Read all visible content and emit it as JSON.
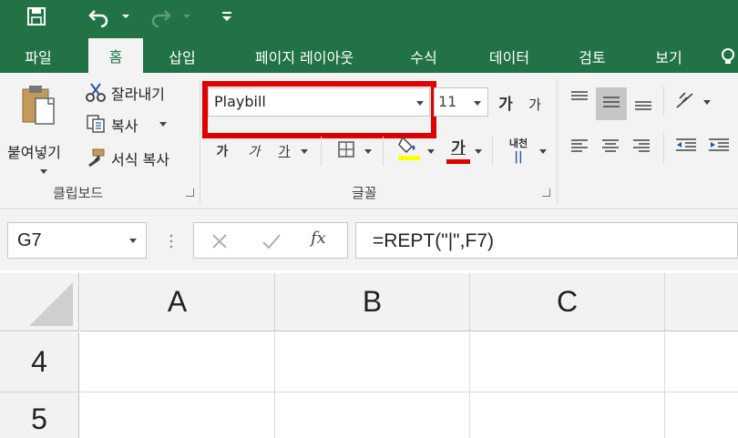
{
  "qat": {
    "save_icon": "save-icon",
    "undo_icon": "undo-icon",
    "redo_icon": "redo-icon",
    "customize_icon": "customize-icon"
  },
  "tabs": [
    {
      "label": "파일"
    },
    {
      "label": "홈"
    },
    {
      "label": "삽입"
    },
    {
      "label": "페이지 레이아웃"
    },
    {
      "label": "수식"
    },
    {
      "label": "데이터"
    },
    {
      "label": "검토"
    },
    {
      "label": "보기"
    }
  ],
  "clipboard": {
    "paste_label": "붙여넣기",
    "cut_label": "잘라내기",
    "copy_label": "복사",
    "format_painter_label": "서식 복사",
    "group_label": "클립보드"
  },
  "font": {
    "name": "Playbill",
    "size": "11",
    "grow_label": "가",
    "shrink_label": "가",
    "bold_label": "가",
    "italic_label": "가",
    "underline_label": "가",
    "font_color_label": "가",
    "phonetic_label": "내천",
    "group_label": "글꼴"
  },
  "colors": {
    "brand": "#217346",
    "highlight_fill": "#ffff00",
    "font_color": "#e00000",
    "callout": "#e00000"
  },
  "formula_bar": {
    "name_box": "G7",
    "formula": "=REPT(\"|\",F7)",
    "fx_label": "fx"
  },
  "grid": {
    "columns": [
      "A",
      "B",
      "C"
    ],
    "rows": [
      "4",
      "5"
    ]
  }
}
